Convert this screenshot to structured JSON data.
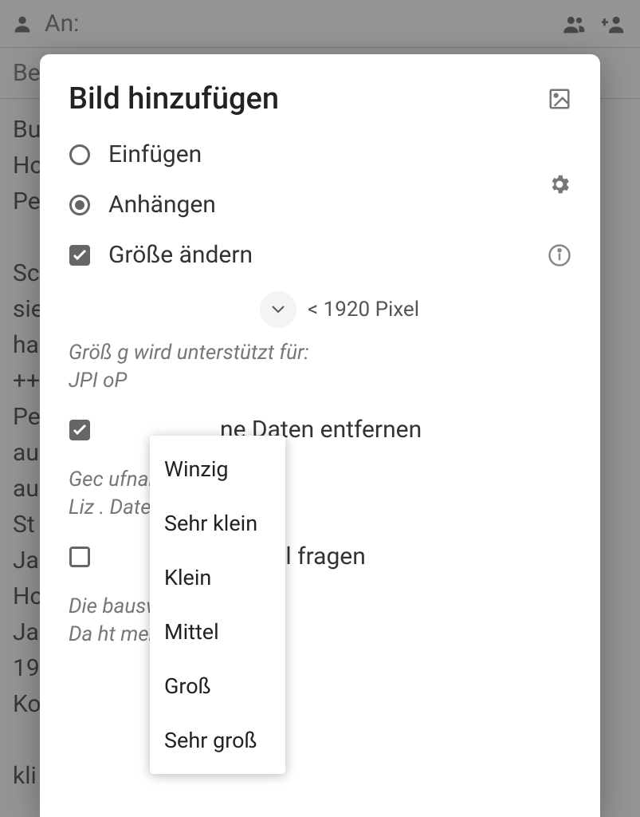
{
  "background": {
    "to_label": "An:",
    "subject_placeholder": "Be",
    "body_text": "Bu                                           s,\nHo\nPe\n\nSc                                              n\nsie\nha\n++\nPe                                             n\nau\nau                                            r,\nSt\nJa                                            ge\nHo\nJa\n19\nKo\n   \nkli"
  },
  "dialog": {
    "title": "Bild hinzufügen",
    "insert_label": "Einfügen",
    "attach_label": "Anhängen",
    "resize_label": "Größe ändern",
    "pixel_text": "< 1920 Pixel",
    "resize_hint_line1": "Größ                     g wird unterstützt für:",
    "resize_hint_line2": "JPI                        oP",
    "remove_data_label": "ne Daten entfernen",
    "remove_hint_line1": "Gec                       ufnahmeort,",
    "remove_hint_line2": "Liz                       . Dateinamen usw.",
    "ask_label": "einmal fragen",
    "ask_hint_line1": "Die                        bauswahl übergibt",
    "ask_hint_line2": "Da                        ht mehr"
  },
  "dropdown": {
    "items": [
      "Winzig",
      "Sehr klein",
      "Klein",
      "Mittel",
      "Groß",
      "Sehr groß"
    ]
  }
}
